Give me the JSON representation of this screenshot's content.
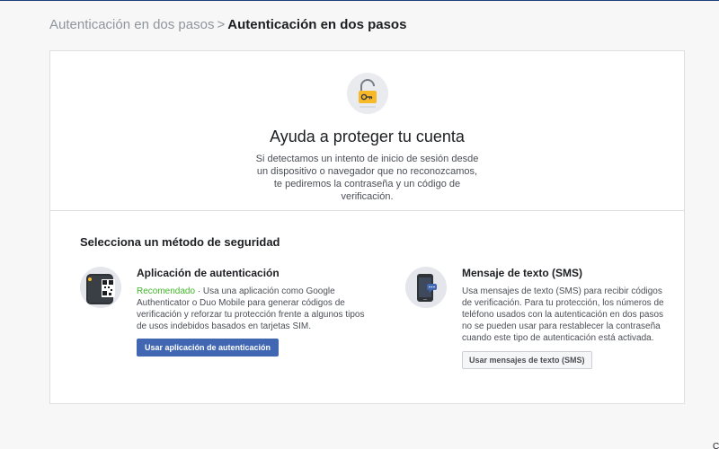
{
  "breadcrumb": {
    "parent": "Autenticación en dos pasos",
    "separator": ">",
    "current": "Autenticación en dos pasos"
  },
  "hero": {
    "icon": "lock-key-icon",
    "title": "Ayuda a proteger tu cuenta",
    "description": "Si detectamos un intento de inicio de sesión desde un dispositivo o navegador que no reconozcamos, te pediremos la contraseña y un código de verificación."
  },
  "methods": {
    "section_title": "Selecciona un método de seguridad",
    "auth_app": {
      "icon": "authenticator-phone-icon",
      "title": "Aplicación de autenticación",
      "recommended": "Recomendado",
      "description": " · Usa una aplicación como Google Authenticator o Duo Mobile para generar códigos de verificación y reforzar tu protección frente a algunos tipos de usos indebidos basados en tarjetas SIM.",
      "button": "Usar aplicación de autenticación"
    },
    "sms": {
      "icon": "sms-phone-icon",
      "title": "Mensaje de texto (SMS)",
      "description": "Usa mensajes de texto (SMS) para recibir códigos de verificación. Para tu protección, los números de teléfono usados con la autenticación en dos pasos no se pueden usar para restablecer la contraseña cuando este tipo de autenticación está activada.",
      "button": "Usar mensajes de texto (SMS)"
    }
  },
  "corner_fragment": "C",
  "colors": {
    "primary": "#4267b2",
    "recommended": "#42b72a",
    "lock": "#f7b928",
    "top_rule": "#1d3f7a"
  }
}
